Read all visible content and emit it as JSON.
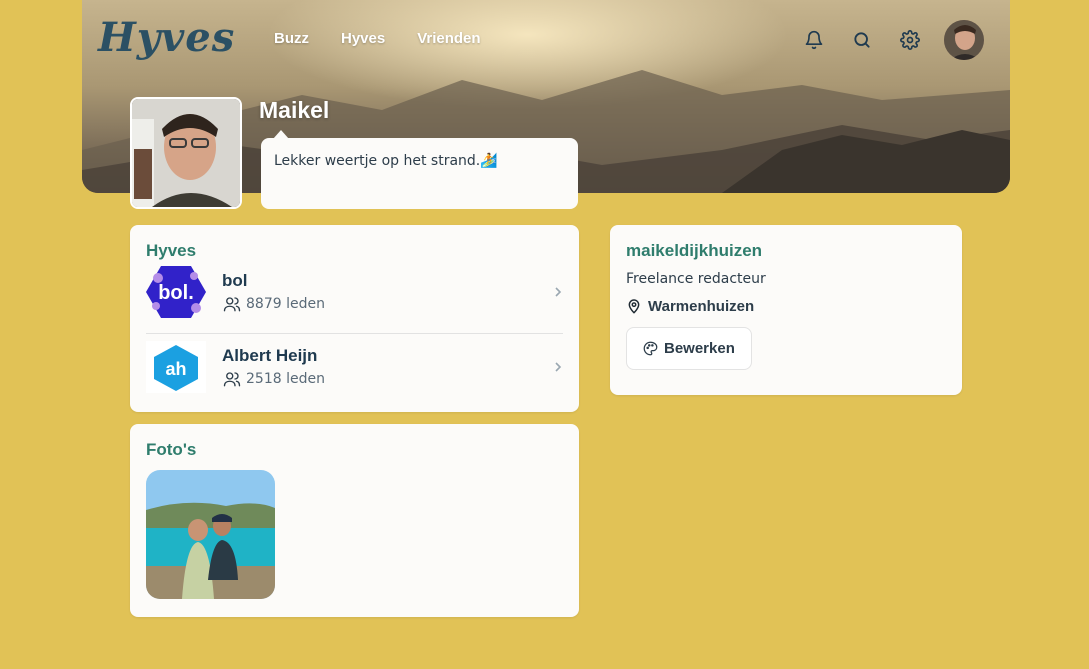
{
  "brand": {
    "logo_text": "Hyves"
  },
  "nav": [
    {
      "label": "Buzz"
    },
    {
      "label": "Hyves"
    },
    {
      "label": "Vrienden"
    }
  ],
  "top_icons": [
    "bell-icon",
    "search-icon",
    "gear-icon"
  ],
  "profile": {
    "name": "Maikel",
    "status": "Lekker weertje op het strand.",
    "status_emoji": "🏄"
  },
  "hyves_section": {
    "title": "Hyves",
    "items": [
      {
        "name": "bol",
        "members": "8879 leden"
      },
      {
        "name": "Albert Heijn",
        "members": "2518 leden"
      }
    ]
  },
  "photos_section": {
    "title": "Foto's"
  },
  "info": {
    "username": "maikeldijkhuizen",
    "occupation": "Freelance redacteur",
    "location": "Warmenhuizen",
    "edit_label": "Bewerken"
  },
  "colors": {
    "accent": "#2f7d6d",
    "background": "#e1c256",
    "text": "#1f3a4f"
  }
}
